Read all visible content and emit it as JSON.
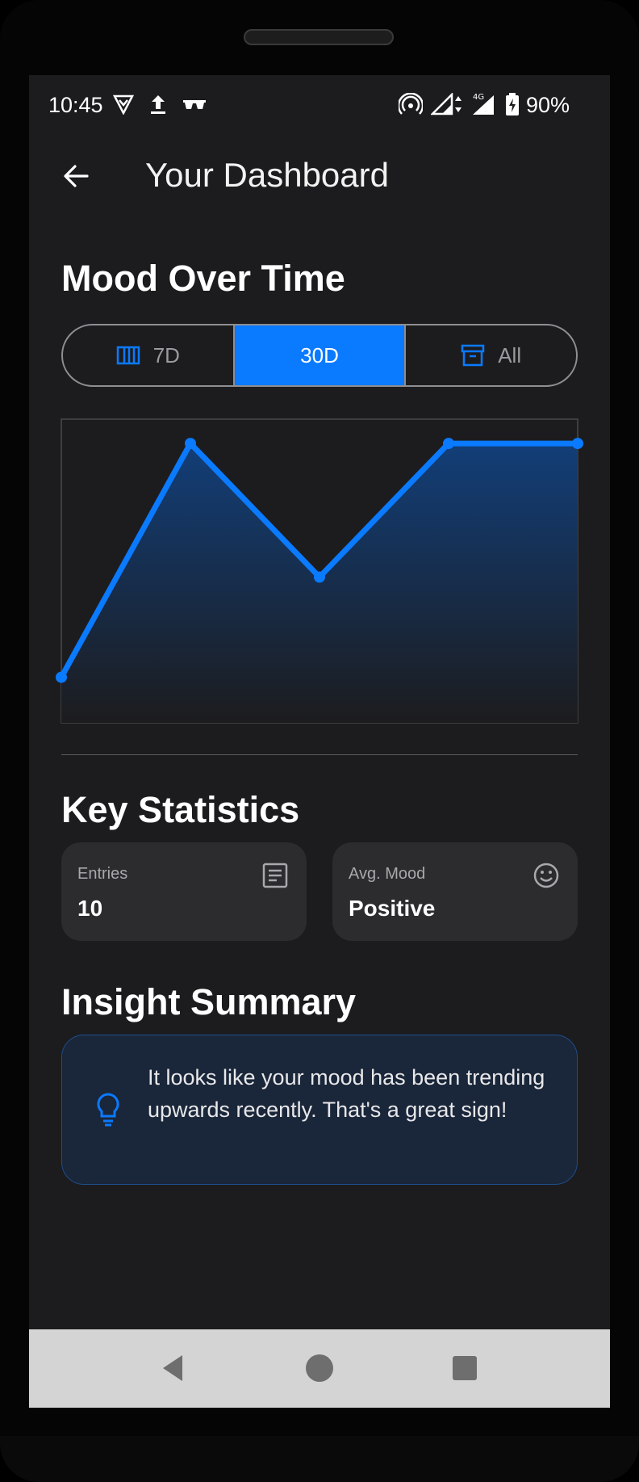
{
  "status_bar": {
    "time": "10:45",
    "battery": "90%",
    "network_type": "4G"
  },
  "app_bar": {
    "title": "Your Dashboard",
    "back_icon": "arrow-back-icon"
  },
  "mood_section": {
    "heading": "Mood Over Time",
    "ranges": [
      {
        "label": "7D",
        "icon": "view-week-icon",
        "selected": false
      },
      {
        "label": "30D",
        "icon": "",
        "selected": true
      },
      {
        "label": "All",
        "icon": "archive-icon",
        "selected": false
      }
    ]
  },
  "chart_data": {
    "type": "line",
    "title": "",
    "xlabel": "",
    "ylabel": "",
    "x": [
      1,
      2,
      3,
      4,
      5
    ],
    "values": [
      0.15,
      0.92,
      0.48,
      0.92,
      0.92
    ],
    "ylim": [
      0,
      1
    ],
    "grid": false,
    "line_color": "#0a7aff",
    "fill_color": "#123e78"
  },
  "stats_section": {
    "heading": "Key Statistics",
    "cards": [
      {
        "label": "Entries",
        "value": "10",
        "icon": "article-icon"
      },
      {
        "label": "Avg. Mood",
        "value": "Positive",
        "icon": "smiley-face-icon"
      }
    ]
  },
  "insight_section": {
    "heading": "Insight Summary",
    "text": "It looks like your mood has been trending upwards recently. That's a great sign!",
    "icon": "lightbulb-icon"
  },
  "colors": {
    "accent": "#0a7aff",
    "background": "#1c1c1e",
    "card": "#2c2c2e"
  }
}
